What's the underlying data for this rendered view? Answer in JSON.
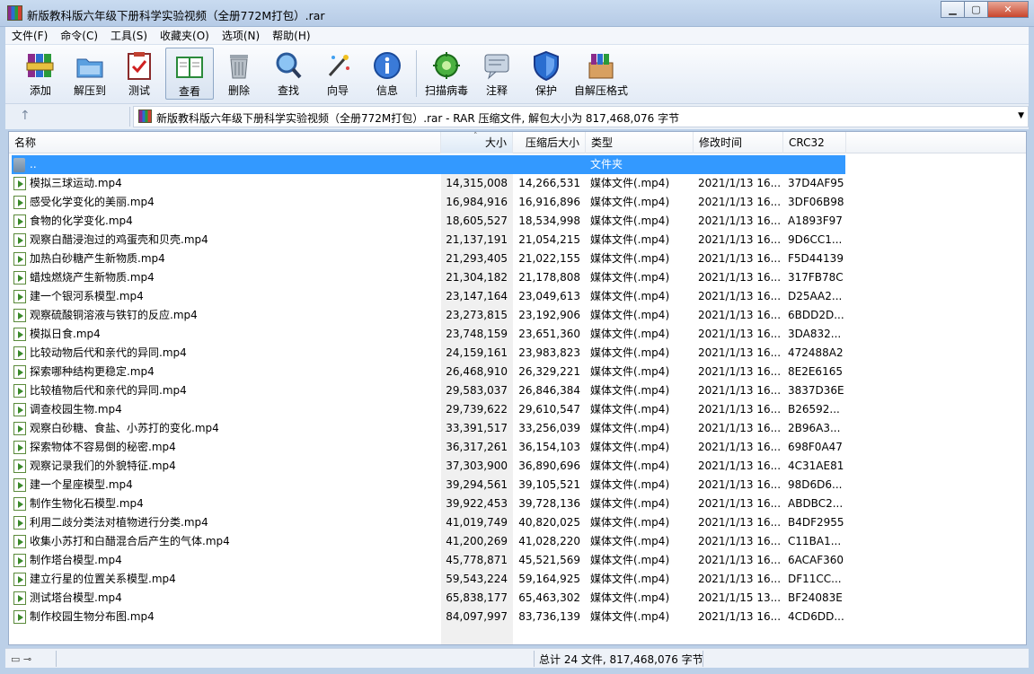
{
  "window": {
    "title": "新版教科版六年级下册科学实验视频（全册772M打包）.rar",
    "controls": {
      "minimize": "▁",
      "maximize": "▢",
      "close": "✕"
    }
  },
  "menu": [
    "文件(F)",
    "命令(C)",
    "工具(S)",
    "收藏夹(O)",
    "选项(N)",
    "帮助(H)"
  ],
  "toolbar": {
    "buttons": [
      {
        "label": "添加",
        "icon": "books-stack-icon"
      },
      {
        "label": "解压到",
        "icon": "folder-extract-icon"
      },
      {
        "label": "测试",
        "icon": "clipboard-check-icon"
      },
      {
        "label": "查看",
        "icon": "open-book-icon"
      },
      {
        "label": "删除",
        "icon": "trash-can-icon"
      },
      {
        "label": "查找",
        "icon": "magnifier-icon"
      },
      {
        "label": "向导",
        "icon": "magic-wand-icon"
      },
      {
        "label": "信息",
        "icon": "info-icon"
      },
      {
        "label": "扫描病毒",
        "icon": "virus-scan-icon"
      },
      {
        "label": "注释",
        "icon": "comment-icon"
      },
      {
        "label": "保护",
        "icon": "shield-icon"
      },
      {
        "label": "自解压格式",
        "icon": "sfx-box-icon"
      }
    ]
  },
  "address": {
    "up": "↑",
    "path": "新版教科版六年级下册科学实验视频（全册772M打包）.rar - RAR 压缩文件, 解包大小为 817,468,076 字节",
    "dropdown": "▼"
  },
  "list": {
    "columns": {
      "name": "名称",
      "size": "大小",
      "packed": "压缩后大小",
      "type": "类型",
      "mtime": "修改时间",
      "crc": "CRC32",
      "sort_arrow": "˄"
    },
    "parent": {
      "name": "..",
      "type": "文件夹"
    },
    "files": [
      {
        "name": "模拟三球运动.mp4",
        "size": "14,315,008",
        "packed": "14,266,531",
        "type": "媒体文件(.mp4)",
        "mtime": "2021/1/13 16...",
        "crc": "37D4AF95"
      },
      {
        "name": "感受化学变化的美丽.mp4",
        "size": "16,984,916",
        "packed": "16,916,896",
        "type": "媒体文件(.mp4)",
        "mtime": "2021/1/13 16...",
        "crc": "3DF06B98"
      },
      {
        "name": "食物的化学变化.mp4",
        "size": "18,605,527",
        "packed": "18,534,998",
        "type": "媒体文件(.mp4)",
        "mtime": "2021/1/13 16...",
        "crc": "A1893F97"
      },
      {
        "name": "观察白醋浸泡过的鸡蛋壳和贝壳.mp4",
        "size": "21,137,191",
        "packed": "21,054,215",
        "type": "媒体文件(.mp4)",
        "mtime": "2021/1/13 16...",
        "crc": "9D6CC1..."
      },
      {
        "name": "加热白砂糖产生新物质.mp4",
        "size": "21,293,405",
        "packed": "21,022,155",
        "type": "媒体文件(.mp4)",
        "mtime": "2021/1/13 16...",
        "crc": "F5D44139"
      },
      {
        "name": "蜡烛燃烧产生新物质.mp4",
        "size": "21,304,182",
        "packed": "21,178,808",
        "type": "媒体文件(.mp4)",
        "mtime": "2021/1/13 16...",
        "crc": "317FB78C"
      },
      {
        "name": "建一个银河系模型.mp4",
        "size": "23,147,164",
        "packed": "23,049,613",
        "type": "媒体文件(.mp4)",
        "mtime": "2021/1/13 16...",
        "crc": "D25AA2..."
      },
      {
        "name": "观察硫酸铜溶液与铁钉的反应.mp4",
        "size": "23,273,815",
        "packed": "23,192,906",
        "type": "媒体文件(.mp4)",
        "mtime": "2021/1/13 16...",
        "crc": "6BDD2D..."
      },
      {
        "name": "模拟日食.mp4",
        "size": "23,748,159",
        "packed": "23,651,360",
        "type": "媒体文件(.mp4)",
        "mtime": "2021/1/13 16...",
        "crc": "3DA832..."
      },
      {
        "name": "比较动物后代和亲代的异同.mp4",
        "size": "24,159,161",
        "packed": "23,983,823",
        "type": "媒体文件(.mp4)",
        "mtime": "2021/1/13 16...",
        "crc": "472488A2"
      },
      {
        "name": "探索哪种结构更稳定.mp4",
        "size": "26,468,910",
        "packed": "26,329,221",
        "type": "媒体文件(.mp4)",
        "mtime": "2021/1/13 16...",
        "crc": "8E2E6165"
      },
      {
        "name": "比较植物后代和亲代的异同.mp4",
        "size": "29,583,037",
        "packed": "26,846,384",
        "type": "媒体文件(.mp4)",
        "mtime": "2021/1/13 16...",
        "crc": "3837D36E"
      },
      {
        "name": "调查校园生物.mp4",
        "size": "29,739,622",
        "packed": "29,610,547",
        "type": "媒体文件(.mp4)",
        "mtime": "2021/1/13 16...",
        "crc": "B26592..."
      },
      {
        "name": "观察白砂糖、食盐、小苏打的变化.mp4",
        "size": "33,391,517",
        "packed": "33,256,039",
        "type": "媒体文件(.mp4)",
        "mtime": "2021/1/13 16...",
        "crc": "2B96A3..."
      },
      {
        "name": "探索物体不容易倒的秘密.mp4",
        "size": "36,317,261",
        "packed": "36,154,103",
        "type": "媒体文件(.mp4)",
        "mtime": "2021/1/13 16...",
        "crc": "698F0A47"
      },
      {
        "name": "观察记录我们的外貌特征.mp4",
        "size": "37,303,900",
        "packed": "36,890,696",
        "type": "媒体文件(.mp4)",
        "mtime": "2021/1/13 16...",
        "crc": "4C31AE81"
      },
      {
        "name": "建一个星座模型.mp4",
        "size": "39,294,561",
        "packed": "39,105,521",
        "type": "媒体文件(.mp4)",
        "mtime": "2021/1/13 16...",
        "crc": "98D6D6..."
      },
      {
        "name": "制作生物化石模型.mp4",
        "size": "39,922,453",
        "packed": "39,728,136",
        "type": "媒体文件(.mp4)",
        "mtime": "2021/1/13 16...",
        "crc": "ABDBC2..."
      },
      {
        "name": "利用二歧分类法对植物进行分类.mp4",
        "size": "41,019,749",
        "packed": "40,820,025",
        "type": "媒体文件(.mp4)",
        "mtime": "2021/1/13 16...",
        "crc": "B4DF2955"
      },
      {
        "name": "收集小苏打和白醋混合后产生的气体.mp4",
        "size": "41,200,269",
        "packed": "41,028,220",
        "type": "媒体文件(.mp4)",
        "mtime": "2021/1/13 16...",
        "crc": "C11BA1..."
      },
      {
        "name": "制作塔台模型.mp4",
        "size": "45,778,871",
        "packed": "45,521,569",
        "type": "媒体文件(.mp4)",
        "mtime": "2021/1/13 16...",
        "crc": "6ACAF360"
      },
      {
        "name": "建立行星的位置关系模型.mp4",
        "size": "59,543,224",
        "packed": "59,164,925",
        "type": "媒体文件(.mp4)",
        "mtime": "2021/1/13 16...",
        "crc": "DF11CC..."
      },
      {
        "name": "测试塔台模型.mp4",
        "size": "65,838,177",
        "packed": "65,463,302",
        "type": "媒体文件(.mp4)",
        "mtime": "2021/1/15 13...",
        "crc": "BF24083E"
      },
      {
        "name": "制作校园生物分布图.mp4",
        "size": "84,097,997",
        "packed": "83,736,139",
        "type": "媒体文件(.mp4)",
        "mtime": "2021/1/13 16...",
        "crc": "4CD6DD..."
      }
    ]
  },
  "status": {
    "total": "总计 24 文件, 817,468,076 字节",
    "icons": "▭ ⊸"
  }
}
